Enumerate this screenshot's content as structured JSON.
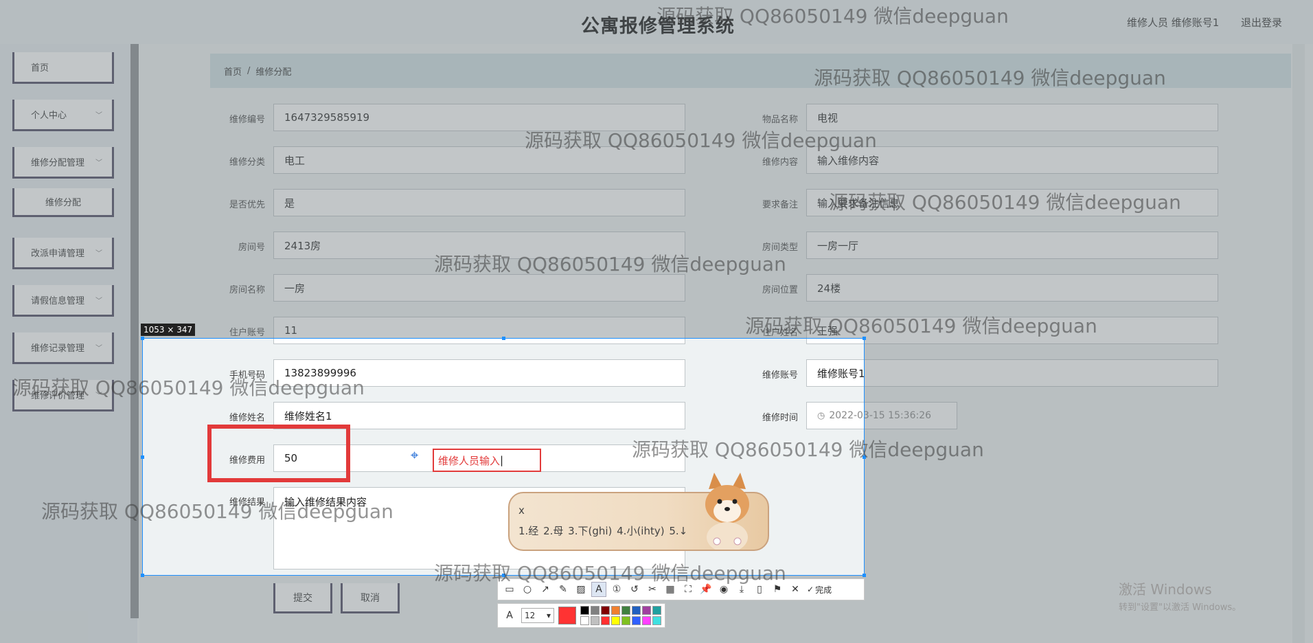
{
  "header": {
    "title": "公寓报修管理系统",
    "user_label": "维修人员 维修账号1",
    "logout_label": "退出登录"
  },
  "sidebar": {
    "items": [
      {
        "label": "首页",
        "has_chevron": false
      },
      {
        "label": "个人中心",
        "has_chevron": true
      },
      {
        "label": "维修分配管理",
        "has_chevron": true
      },
      {
        "label": "维修分配",
        "has_chevron": false,
        "sub": true
      },
      {
        "label": "改派申请管理",
        "has_chevron": true
      },
      {
        "label": "请假信息管理",
        "has_chevron": true
      },
      {
        "label": "维修记录管理",
        "has_chevron": true
      },
      {
        "label": "维修评价管理",
        "has_chevron": true
      }
    ]
  },
  "breadcrumb": {
    "home": "首页",
    "separator": "/",
    "current": "维修分配"
  },
  "form": {
    "repair_no": {
      "label": "维修编号",
      "value": "1647329585919"
    },
    "item_name": {
      "label": "物品名称",
      "value": "电视"
    },
    "repair_category": {
      "label": "维修分类",
      "value": "电工"
    },
    "repair_content": {
      "label": "维修内容",
      "value": "输入维修内容"
    },
    "priority": {
      "label": "是否优先",
      "value": "是"
    },
    "remark": {
      "label": "要求备注",
      "value": "输入要求备注信息"
    },
    "room_no": {
      "label": "房间号",
      "value": "2413房"
    },
    "room_type": {
      "label": "房间类型",
      "value": "一房一厅"
    },
    "room_name": {
      "label": "房间名称",
      "value": "一房"
    },
    "room_location": {
      "label": "房间位置",
      "value": "24楼"
    },
    "resident_account": {
      "label": "住户账号",
      "value": "11"
    },
    "resident_name": {
      "label": "住户姓名",
      "value": "王强"
    },
    "phone": {
      "label": "手机号码",
      "value": "13823899996"
    },
    "repair_account": {
      "label": "维修账号",
      "value": "维修账号1"
    },
    "repair_name": {
      "label": "维修姓名",
      "value": "维修姓名1"
    },
    "repair_time": {
      "label": "维修时间",
      "value": "2022-03-15 15:36:26"
    },
    "repair_fee": {
      "label": "维修费用",
      "value": "50"
    },
    "repair_result": {
      "label": "维修结果",
      "value": "输入维修结果内容"
    },
    "submit_label": "提交",
    "cancel_label": "取消"
  },
  "screenshot_tool": {
    "dimensions_label": "1053 × 347",
    "annotation_text": "维修人员输入",
    "done_label": "完成",
    "font_size": "12",
    "current_color": "#ff3333",
    "palette": [
      "#000000",
      "#808080",
      "#800000",
      "#f08030",
      "#408040",
      "#2060c0",
      "#a040a0",
      "#20a0a0",
      "#ffffff",
      "#c0c0c0",
      "#ff3030",
      "#ffff00",
      "#80c020",
      "#3060ff",
      "#ff40ff",
      "#40e0e0"
    ],
    "icons": [
      "rectangle-icon",
      "ellipse-icon",
      "arrow-icon",
      "pen-icon",
      "mosaic-icon",
      "text-icon",
      "number-icon",
      "undo-icon",
      "cut-icon",
      "ocr-icon",
      "scroll-capture-icon",
      "pin-icon",
      "record-icon",
      "download-icon",
      "phone-icon",
      "bookmark-icon",
      "close-icon",
      "check-icon"
    ]
  },
  "ime": {
    "typed": "x",
    "candidates": "1.经  2.母  3.下(ghi)  4.小(ihty)  5.↓"
  },
  "watermark": "源码获取 QQ86050149 微信deepguan",
  "os_notice": {
    "line1": "激活 Windows",
    "line2": "转到\"设置\"以激活 Windows。"
  }
}
